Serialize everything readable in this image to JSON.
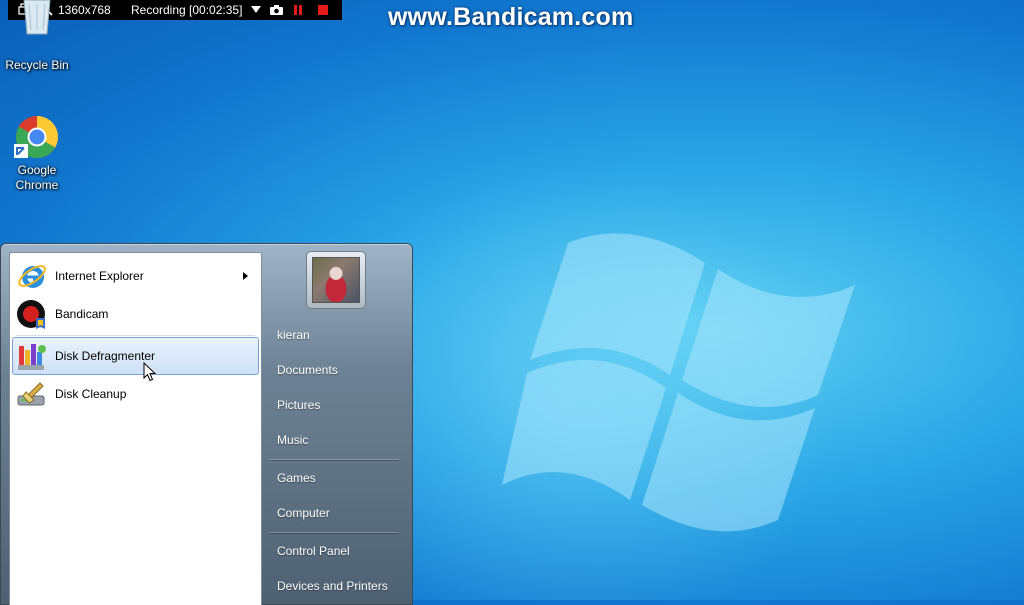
{
  "recorder": {
    "resolution": "1360x768",
    "status": "Recording [00:02:35]",
    "watermark": "www.Bandicam.com"
  },
  "desktop": {
    "icons": [
      {
        "label": "Recycle Bin",
        "icon": "recycle-bin-icon"
      },
      {
        "label": "Google Chrome",
        "icon": "chrome-icon"
      }
    ]
  },
  "start_menu": {
    "programs": [
      {
        "label": "Internet Explorer",
        "icon": "internet-explorer-icon",
        "has_submenu": true
      },
      {
        "label": "Bandicam",
        "icon": "bandicam-icon"
      },
      {
        "label": "Disk Defragmenter",
        "icon": "disk-defragmenter-icon",
        "highlighted": true
      },
      {
        "label": "Disk Cleanup",
        "icon": "disk-cleanup-icon"
      }
    ],
    "user": "kieran",
    "places": [
      "Documents",
      "Pictures",
      "Music",
      "Games",
      "Computer",
      "Control Panel",
      "Devices and Printers"
    ]
  },
  "colors": {
    "desktop_blue": "#1a8ad9",
    "highlight_border": "#7da2ce",
    "record_red": "#e21a1a"
  }
}
